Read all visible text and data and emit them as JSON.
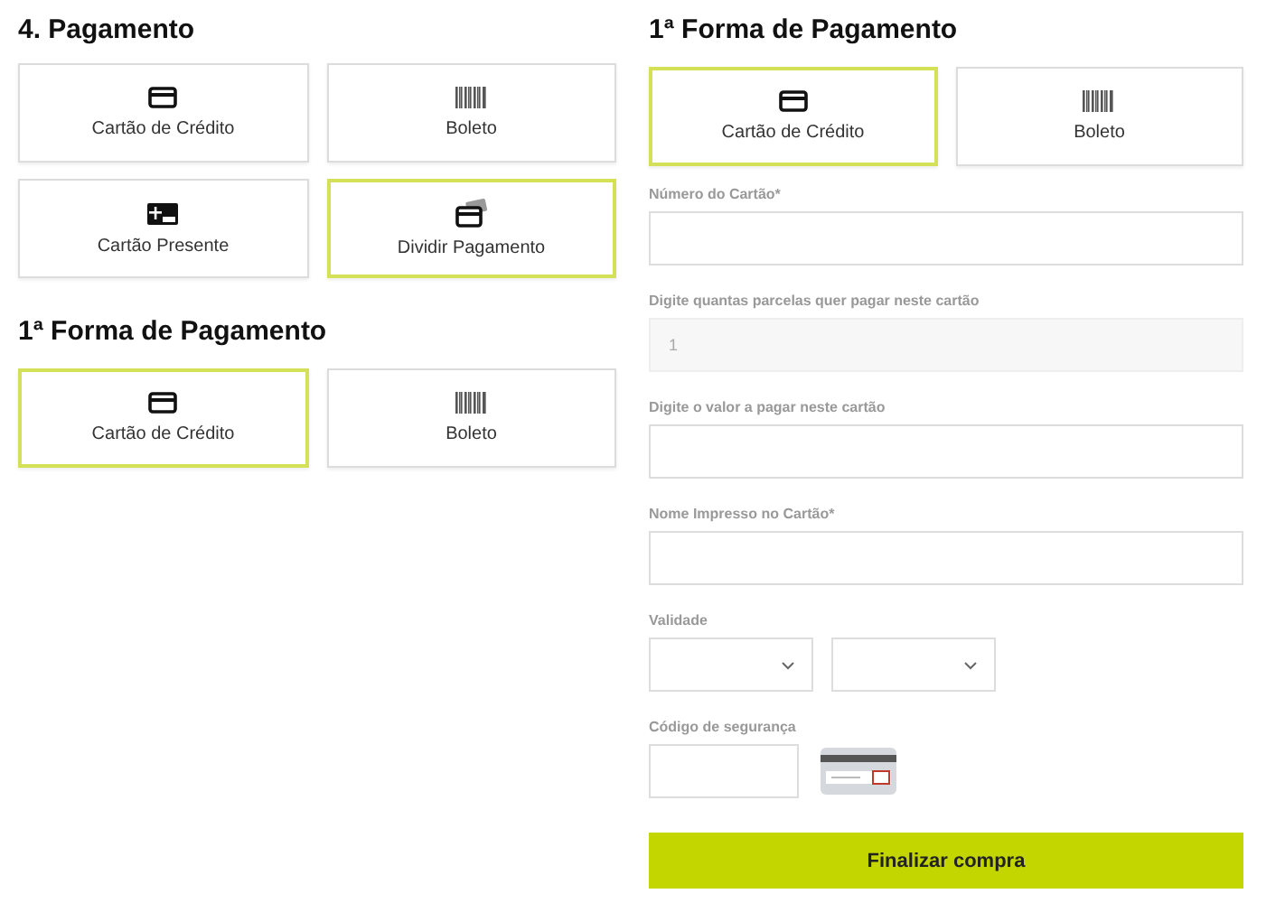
{
  "payment": {
    "title": "4. Pagamento",
    "options": [
      {
        "kind": "card",
        "label": "Cartão de Crédito",
        "selected": false
      },
      {
        "kind": "barcode",
        "label": "Boleto",
        "selected": false
      },
      {
        "kind": "gift",
        "label": "Cartão Presente",
        "selected": false
      },
      {
        "kind": "split",
        "label": "Dividir Pagamento",
        "selected": true
      }
    ]
  },
  "first_method": {
    "title": "1ª Forma de Pagamento",
    "options": [
      {
        "kind": "card",
        "label": "Cartão de Crédito",
        "selected": true
      },
      {
        "kind": "barcode",
        "label": "Boleto",
        "selected": false
      }
    ]
  },
  "form": {
    "title": "1ª Forma de Pagamento",
    "options": [
      {
        "kind": "card",
        "label": "Cartão de Crédito",
        "selected": true
      },
      {
        "kind": "barcode",
        "label": "Boleto",
        "selected": false
      }
    ],
    "fields": [
      {
        "kind": "text",
        "label": "Número do Cartão*",
        "disabled": false
      },
      {
        "kind": "text",
        "label": "Digite quantas parcelas quer pagar neste cartão",
        "value": "1",
        "disabled": true
      },
      {
        "kind": "text",
        "label": "Digite o valor a pagar neste cartão",
        "disabled": false
      },
      {
        "kind": "text",
        "label": "Nome Impresso no Cartão*",
        "disabled": false
      },
      {
        "kind": "expiry",
        "label": "Validade"
      },
      {
        "kind": "cvv",
        "label": "Código de segurança"
      }
    ],
    "submit": "Finalizar compra"
  }
}
